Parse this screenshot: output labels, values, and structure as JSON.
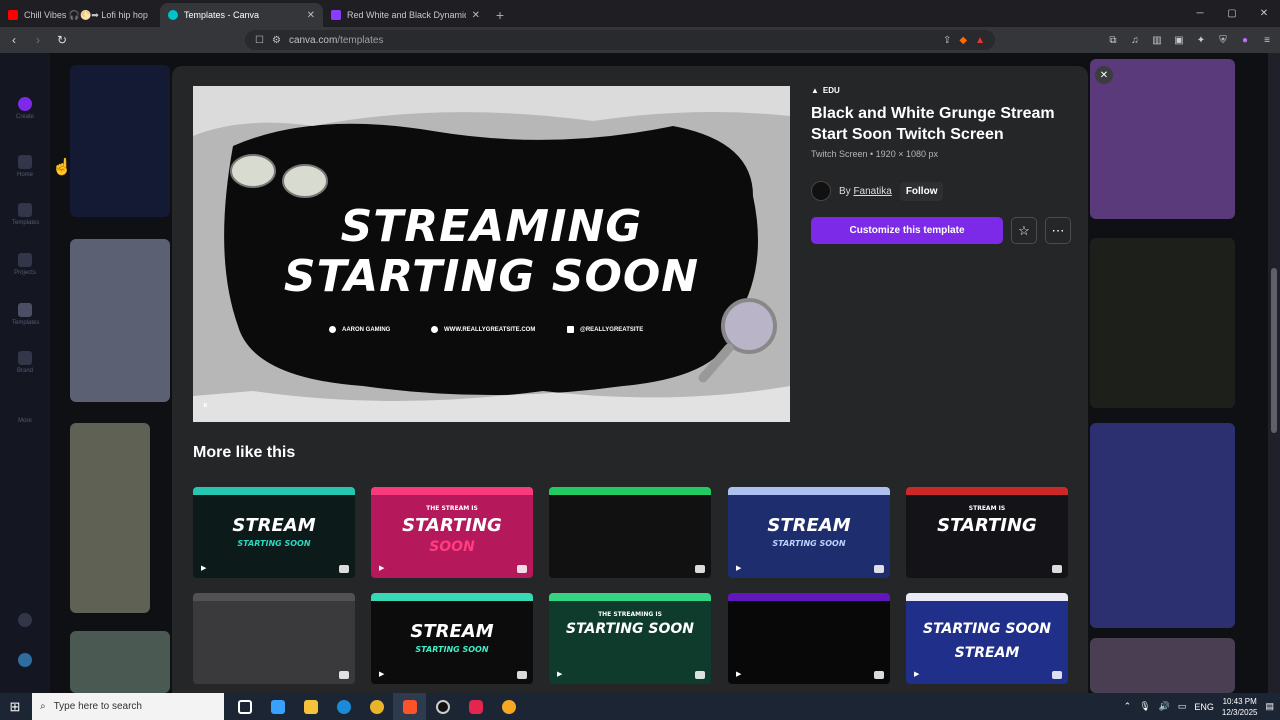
{
  "browser": {
    "tabs": [
      {
        "title": "Chill Vibes 🎧🌕➡ Lofi hip hop",
        "color": "#ff0000"
      },
      {
        "title": "Templates - Canva",
        "color": "#00c4cc"
      },
      {
        "title": "Red White and Black Dynamic Live St",
        "color": "#8b3dff"
      }
    ],
    "close_glyph": "✕",
    "new_tab_glyph": "+",
    "url_host": "canva.com",
    "url_path": "/templates",
    "window_controls": [
      "─",
      "▢",
      "✕"
    ]
  },
  "modal": {
    "badge": "EDU",
    "title": "Black and White Grunge Stream Start Soon Twitch Screen",
    "subtitle": "Twitch Screen • 1920 × 1080 px",
    "author_prefix": "By",
    "author": "Fanatika",
    "follow_label": "Follow",
    "customize_label": "Customize this template",
    "star_icon": "☆",
    "more_icon": "⋯",
    "close_icon": "✕",
    "more_like_this": "More like this",
    "preview": {
      "line1": "STREAMING",
      "line2": "STARTING SOON",
      "info1": "AARON GAMING",
      "info2": "WWW.REALLYGREATSITE.COM",
      "info3": "@REALLYGREATSITE",
      "pause_icon": "⏸"
    }
  },
  "thumbs": [
    {
      "text": "STREAM",
      "sub": "STARTING SOON",
      "bg": "#0d1a1a",
      "accent": "#2ad9c2"
    },
    {
      "text": "STARTING",
      "sub": "SOON",
      "bg": "#b5195c",
      "accent": "#ff3d7f",
      "small": "THE STREAM IS"
    },
    {
      "text": "",
      "sub": "",
      "bg": "#111111",
      "accent": "#23e06b"
    },
    {
      "text": "STREAM",
      "sub": "STARTING SOON",
      "bg": "#1d2d6e",
      "accent": "#bcd2ff"
    },
    {
      "text": "STARTING",
      "sub": "",
      "bg": "#141418",
      "accent": "#e02a2a",
      "small": "STREAM IS"
    },
    {
      "text": "",
      "sub": "",
      "bg": "#3a3a3c",
      "accent": "#555555"
    },
    {
      "text": "STREAM",
      "sub": "STARTING SOON",
      "bg": "#0c0c0c",
      "accent": "#3ef0c8"
    },
    {
      "text": "STARTING SOON",
      "sub": "",
      "bg": "#0e3b2c",
      "accent": "#38e58f",
      "small": "THE STREAMING IS"
    },
    {
      "text": "",
      "sub": "",
      "bg": "#080808",
      "accent": "#6a1bd1"
    },
    {
      "text": "STARTING SOON",
      "sub": "STREAM",
      "bg": "#1f2f8a",
      "accent": "#ffffff"
    }
  ],
  "taskbar": {
    "search_placeholder": "Type here to search",
    "lang": "ENG",
    "time": "10:43 PM",
    "date": "12/3/2025"
  }
}
